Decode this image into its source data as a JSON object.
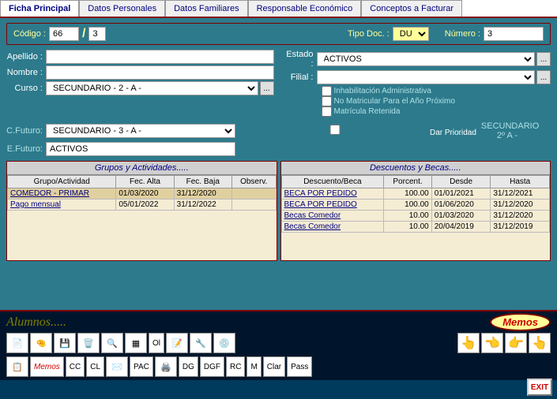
{
  "tabs": {
    "t0": "Ficha Principal",
    "t1": "Datos Personales",
    "t2": "Datos Familiares",
    "t3": "Responsable Económico",
    "t4": "Conceptos a Facturar"
  },
  "code": {
    "label": "Código :",
    "val1": "66",
    "val2": "3",
    "tipo_label": "Tipo Doc. :",
    "tipo_val": "DU",
    "num_label": "Número :",
    "num_val": "3"
  },
  "form": {
    "apellido_lbl": "Apellido :",
    "apellido": "",
    "nombre_lbl": "Nombre :",
    "nombre": "",
    "curso_lbl": "Curso :",
    "curso": "SECUNDARIO - 2 - A -",
    "estado_lbl": "Estado :",
    "estado": "ACTIVOS",
    "filial_lbl": "Filial :",
    "filial": "",
    "chk1": "Inhabilitación Administrativa",
    "chk2": "No Matricular Para el Año Próximo",
    "chk3": "Matrícula Retenida"
  },
  "futuro": {
    "cfut_lbl": "C.Futuro:",
    "cfut": "SECUNDARIO - 3 - A -",
    "efut_lbl": "E.Futuro:",
    "efut": "ACTIVOS",
    "prio": "Dar Prioridad",
    "sec": "SECUNDARIO 2º A -"
  },
  "grupos": {
    "title": "Grupos y Actividades.....",
    "h1": "Grupo/Actividad",
    "h2": "Fec. Alta",
    "h3": "Fec. Baja",
    "h4": "Observ.",
    "rows": [
      {
        "a": "COMEDOR - PRIMAR",
        "b": "01/03/2020",
        "c": "31/12/2020",
        "d": ""
      },
      {
        "a": "Pago mensual",
        "b": "05/01/2022",
        "c": "31/12/2022",
        "d": ""
      }
    ]
  },
  "desc": {
    "title": "Descuentos y Becas.....",
    "h1": "Descuento/Beca",
    "h2": "Porcent.",
    "h3": "Desde",
    "h4": "Hasta",
    "rows": [
      {
        "a": "BECA POR PEDIDO",
        "b": "100.00",
        "c": "01/01/2021",
        "d": "31/12/2021"
      },
      {
        "a": "BECA POR PEDIDO",
        "b": "100.00",
        "c": "01/06/2020",
        "d": "31/12/2020"
      },
      {
        "a": "Becas Comedor",
        "b": "10.00",
        "c": "01/03/2020",
        "d": "31/12/2020"
      },
      {
        "a": "Becas Comedor",
        "b": "10.00",
        "c": "20/04/2019",
        "d": "31/12/2019"
      }
    ]
  },
  "footer": {
    "alumnos": "Alumnos.....",
    "memos": "Memos",
    "memos_btn": "Memos",
    "ol": "Ol",
    "cc": "CC",
    "cl": "CL",
    "pac": "PAC",
    "dg": "DG",
    "dgf": "DGF",
    "rc": "RC",
    "m": "M",
    "clar": "Clar",
    "pass": "Pass",
    "exit": "EXIT"
  }
}
